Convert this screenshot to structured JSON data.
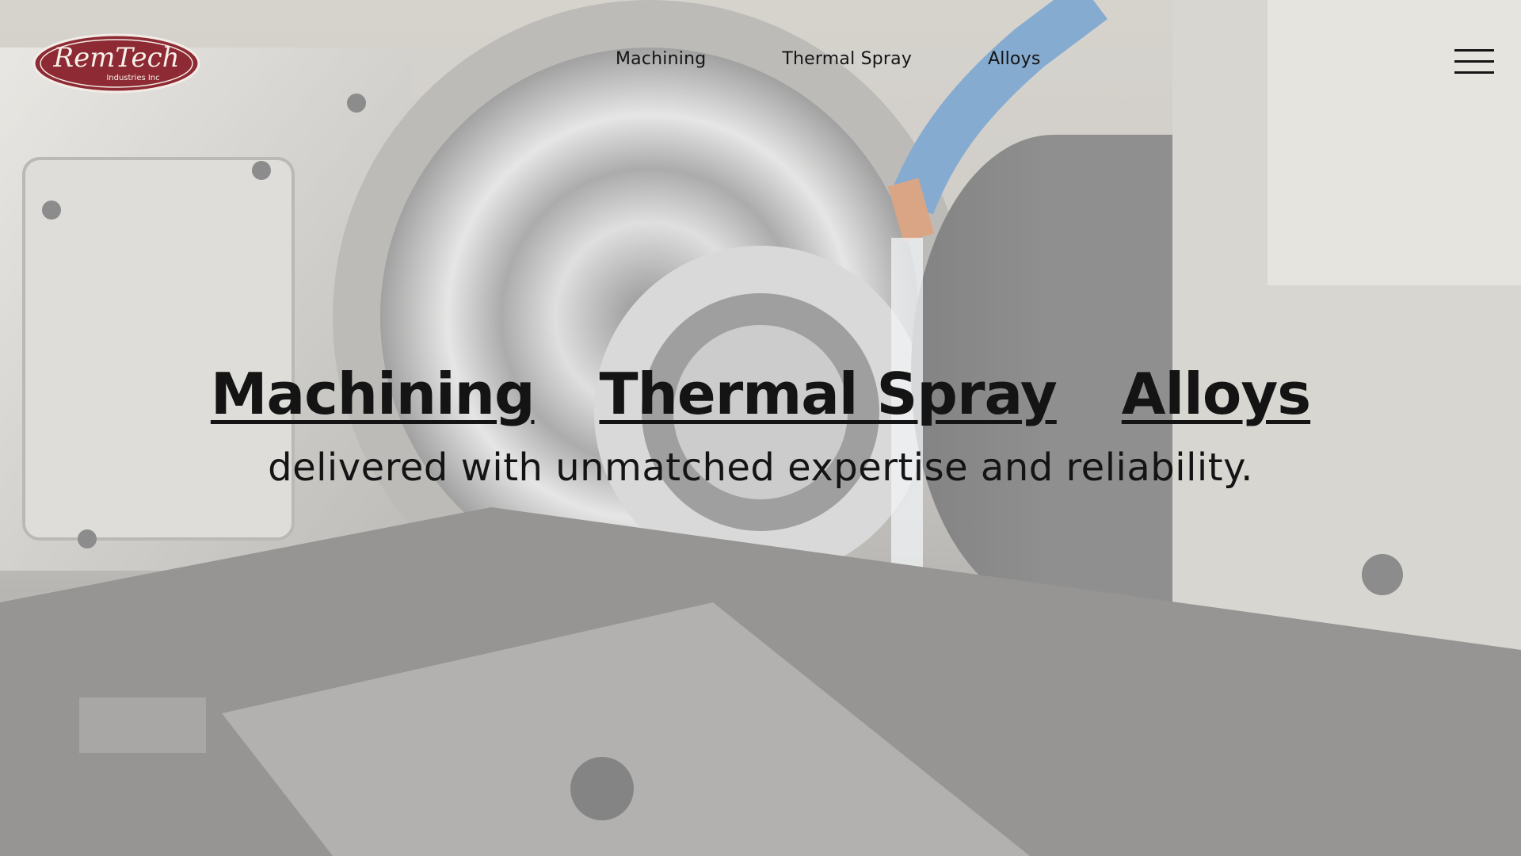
{
  "brand": {
    "logo_primary": "RemTech",
    "logo_secondary": "Industries Inc",
    "logo_color": "#8e2a33"
  },
  "nav": {
    "items": [
      {
        "label": "Machining"
      },
      {
        "label": "Thermal Spray"
      },
      {
        "label": "Alloys"
      }
    ],
    "menu_icon": "hamburger-icon"
  },
  "hero": {
    "services": [
      {
        "label": "Machining"
      },
      {
        "label": "Thermal Spray"
      },
      {
        "label": "Alloys"
      }
    ],
    "tagline": "delivered with unmatched expertise and reliability.",
    "background": "grinding-machine-photo"
  }
}
